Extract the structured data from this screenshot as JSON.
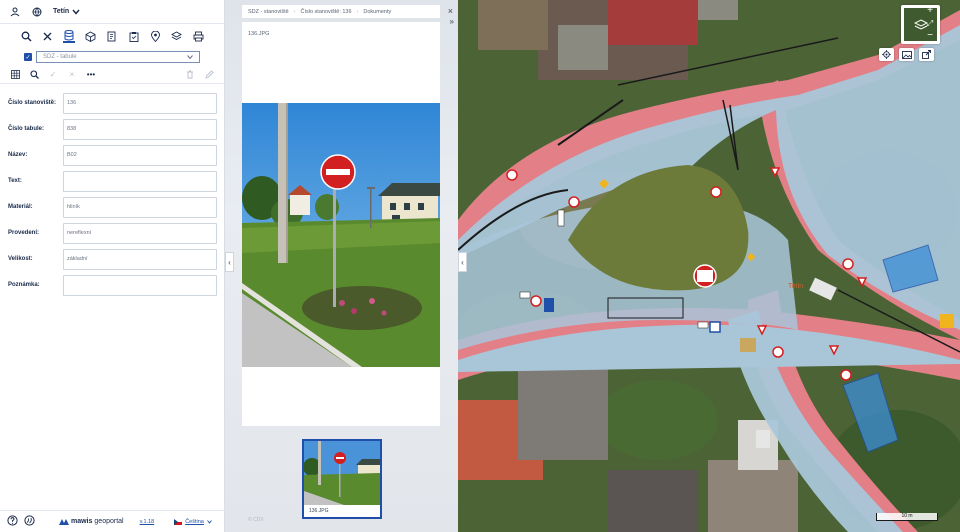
{
  "header": {
    "town": "Tetín"
  },
  "layer_select": {
    "value": "SDZ - tabule"
  },
  "form": {
    "fields": [
      {
        "label": "Číslo stanoviště:",
        "value": "136"
      },
      {
        "label": "Číslo tabule:",
        "value": "838"
      },
      {
        "label": "Název:",
        "value": "B02"
      },
      {
        "label": "Text:",
        "value": ""
      },
      {
        "label": "Materiál:",
        "value": "hliník"
      },
      {
        "label": "Provedení:",
        "value": "nereflexní"
      },
      {
        "label": "Velikost:",
        "value": "základní"
      },
      {
        "label": "Poznámka:",
        "value": ""
      }
    ]
  },
  "footer": {
    "logo_bold": "mawis",
    "logo_light": "geoportal",
    "version": "v.1.18",
    "language": "Čeština"
  },
  "breadcrumb": {
    "items": [
      "SDZ - stanoviště",
      "Číslo stanoviště: 136",
      "Dokumenty"
    ]
  },
  "document": {
    "filename": "136.JPG",
    "thumb_caption": "136.JPG"
  },
  "watermark": "© CDX",
  "map": {
    "scale_label": "10 m",
    "town_label": "Tetín",
    "zoom_in": "+",
    "zoom_out": "−"
  },
  "colors": {
    "accent": "#1f4fa8",
    "road": "#a9c6d9",
    "sidewalk": "#e37f86",
    "vegetation": "#4c6336"
  },
  "icons": {
    "user": "user-icon",
    "globe": "globe-icon",
    "search": "search-icon",
    "tools": "tools-icon",
    "database": "database-icon",
    "cube": "cube-icon",
    "list": "list-edit-icon",
    "clipboard": "clipboard-icon",
    "pin": "pin-icon",
    "layers": "layers-icon",
    "print": "print-icon"
  }
}
